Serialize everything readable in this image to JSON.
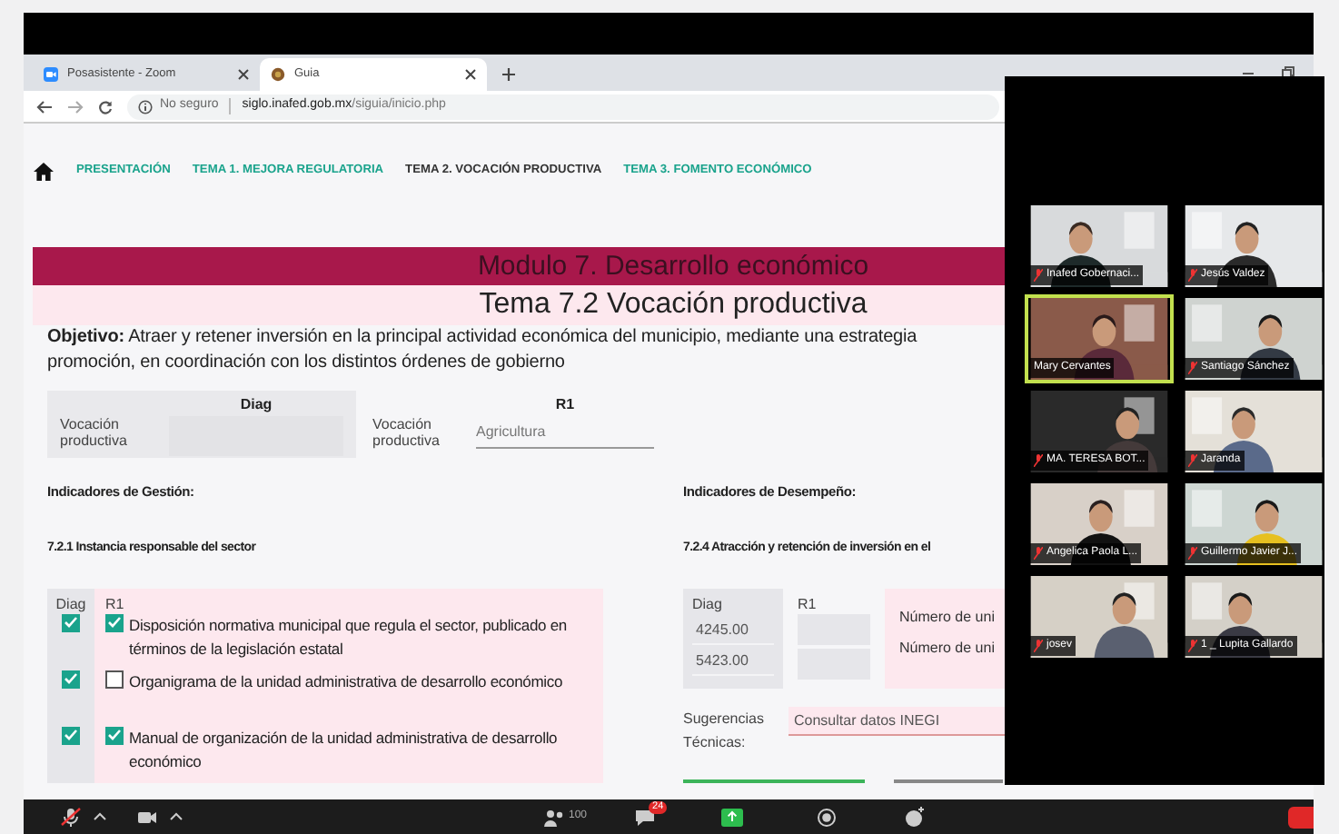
{
  "browser": {
    "tabs": [
      {
        "title": "Posasistente - Zoom",
        "kind": "zoom",
        "selected": false
      },
      {
        "title": "Guia",
        "kind": "site",
        "selected": true
      }
    ],
    "address": {
      "security": "No seguro",
      "host": "siglo.inafed.gob.mx",
      "path": "/siguia/inicio.php"
    }
  },
  "nav": {
    "items": [
      {
        "label": "PRESENTACIÓN",
        "selected": false
      },
      {
        "label": "TEMA 1. MEJORA REGULATORIA",
        "selected": false
      },
      {
        "label": "TEMA 2. VOCACIÓN PRODUCTIVA",
        "selected": true
      },
      {
        "label": "TEMA 3. FOMENTO ECONÓMICO",
        "selected": false
      }
    ]
  },
  "module_title": "Modulo 7. Desarrollo económico",
  "topic_title": "Tema 7.2 Vocación productiva",
  "objective_lines": [
    "**Objetivo:** Atraer y retener inversión en la principal actividad económica del municipio, mediante una estrategia",
    "promoción, en coordinación con los distintos órdenes de gobierno"
  ],
  "vocation": {
    "diag": {
      "header": "Diag",
      "label": "Vocación productiva"
    },
    "r1": {
      "header": "R1",
      "label": "Vocación productiva",
      "value": "Agricultura"
    }
  },
  "management": {
    "title": "Indicadores de Gestión:",
    "section": "7.2.1 Instancia responsable del sector",
    "columns": [
      "Diag",
      "R1"
    ],
    "rows": [
      {
        "diag_checked": true,
        "r1_checked": true,
        "text": "Disposición normativa municipal que regula el sector, publicado en términos de la legislación estatal"
      },
      {
        "diag_checked": true,
        "r1_checked": false,
        "text": "Organigrama de la unidad administrativa de desarrollo económico"
      },
      {
        "diag_checked": true,
        "r1_checked": true,
        "text": "Manual de organización de la unidad administrativa de desarrollo económico"
      }
    ]
  },
  "performance": {
    "title": "Indicadores de Desempeño:",
    "section": "7.2.4 Atracción y retención de inversión en el",
    "columns": [
      "Diag",
      "R1"
    ],
    "rows": [
      {
        "diag": "4245.00",
        "label": "Número de uni"
      },
      {
        "diag": "5423.00",
        "label": "Número de uni"
      }
    ],
    "suggestions_label": "Sugerencias Técnicas:",
    "suggestions_value": "Consultar datos INEGI"
  },
  "meeting": {
    "tiles": [
      {
        "name": "Inafed Gobernaci...",
        "muted": true,
        "speaking": false
      },
      {
        "name": "Jesús Valdez",
        "muted": true,
        "speaking": false
      },
      {
        "name": "Mary Cervantes",
        "muted": false,
        "speaking": true
      },
      {
        "name": "Santiago Sánchez",
        "muted": true,
        "speaking": false
      },
      {
        "name": "MA. TERESA BOT...",
        "muted": true,
        "speaking": false
      },
      {
        "name": "Jaranda",
        "muted": true,
        "speaking": false
      },
      {
        "name": "Angelica Paola L...",
        "muted": true,
        "speaking": false
      },
      {
        "name": "Guillermo Javier J...",
        "muted": true,
        "speaking": false
      },
      {
        "name": "josev",
        "muted": true,
        "speaking": false
      },
      {
        "name": "1 _ Lupita Gallardo",
        "muted": true,
        "speaking": false
      }
    ]
  },
  "toolbar": {
    "participants": "100",
    "chat_badge": "24"
  }
}
